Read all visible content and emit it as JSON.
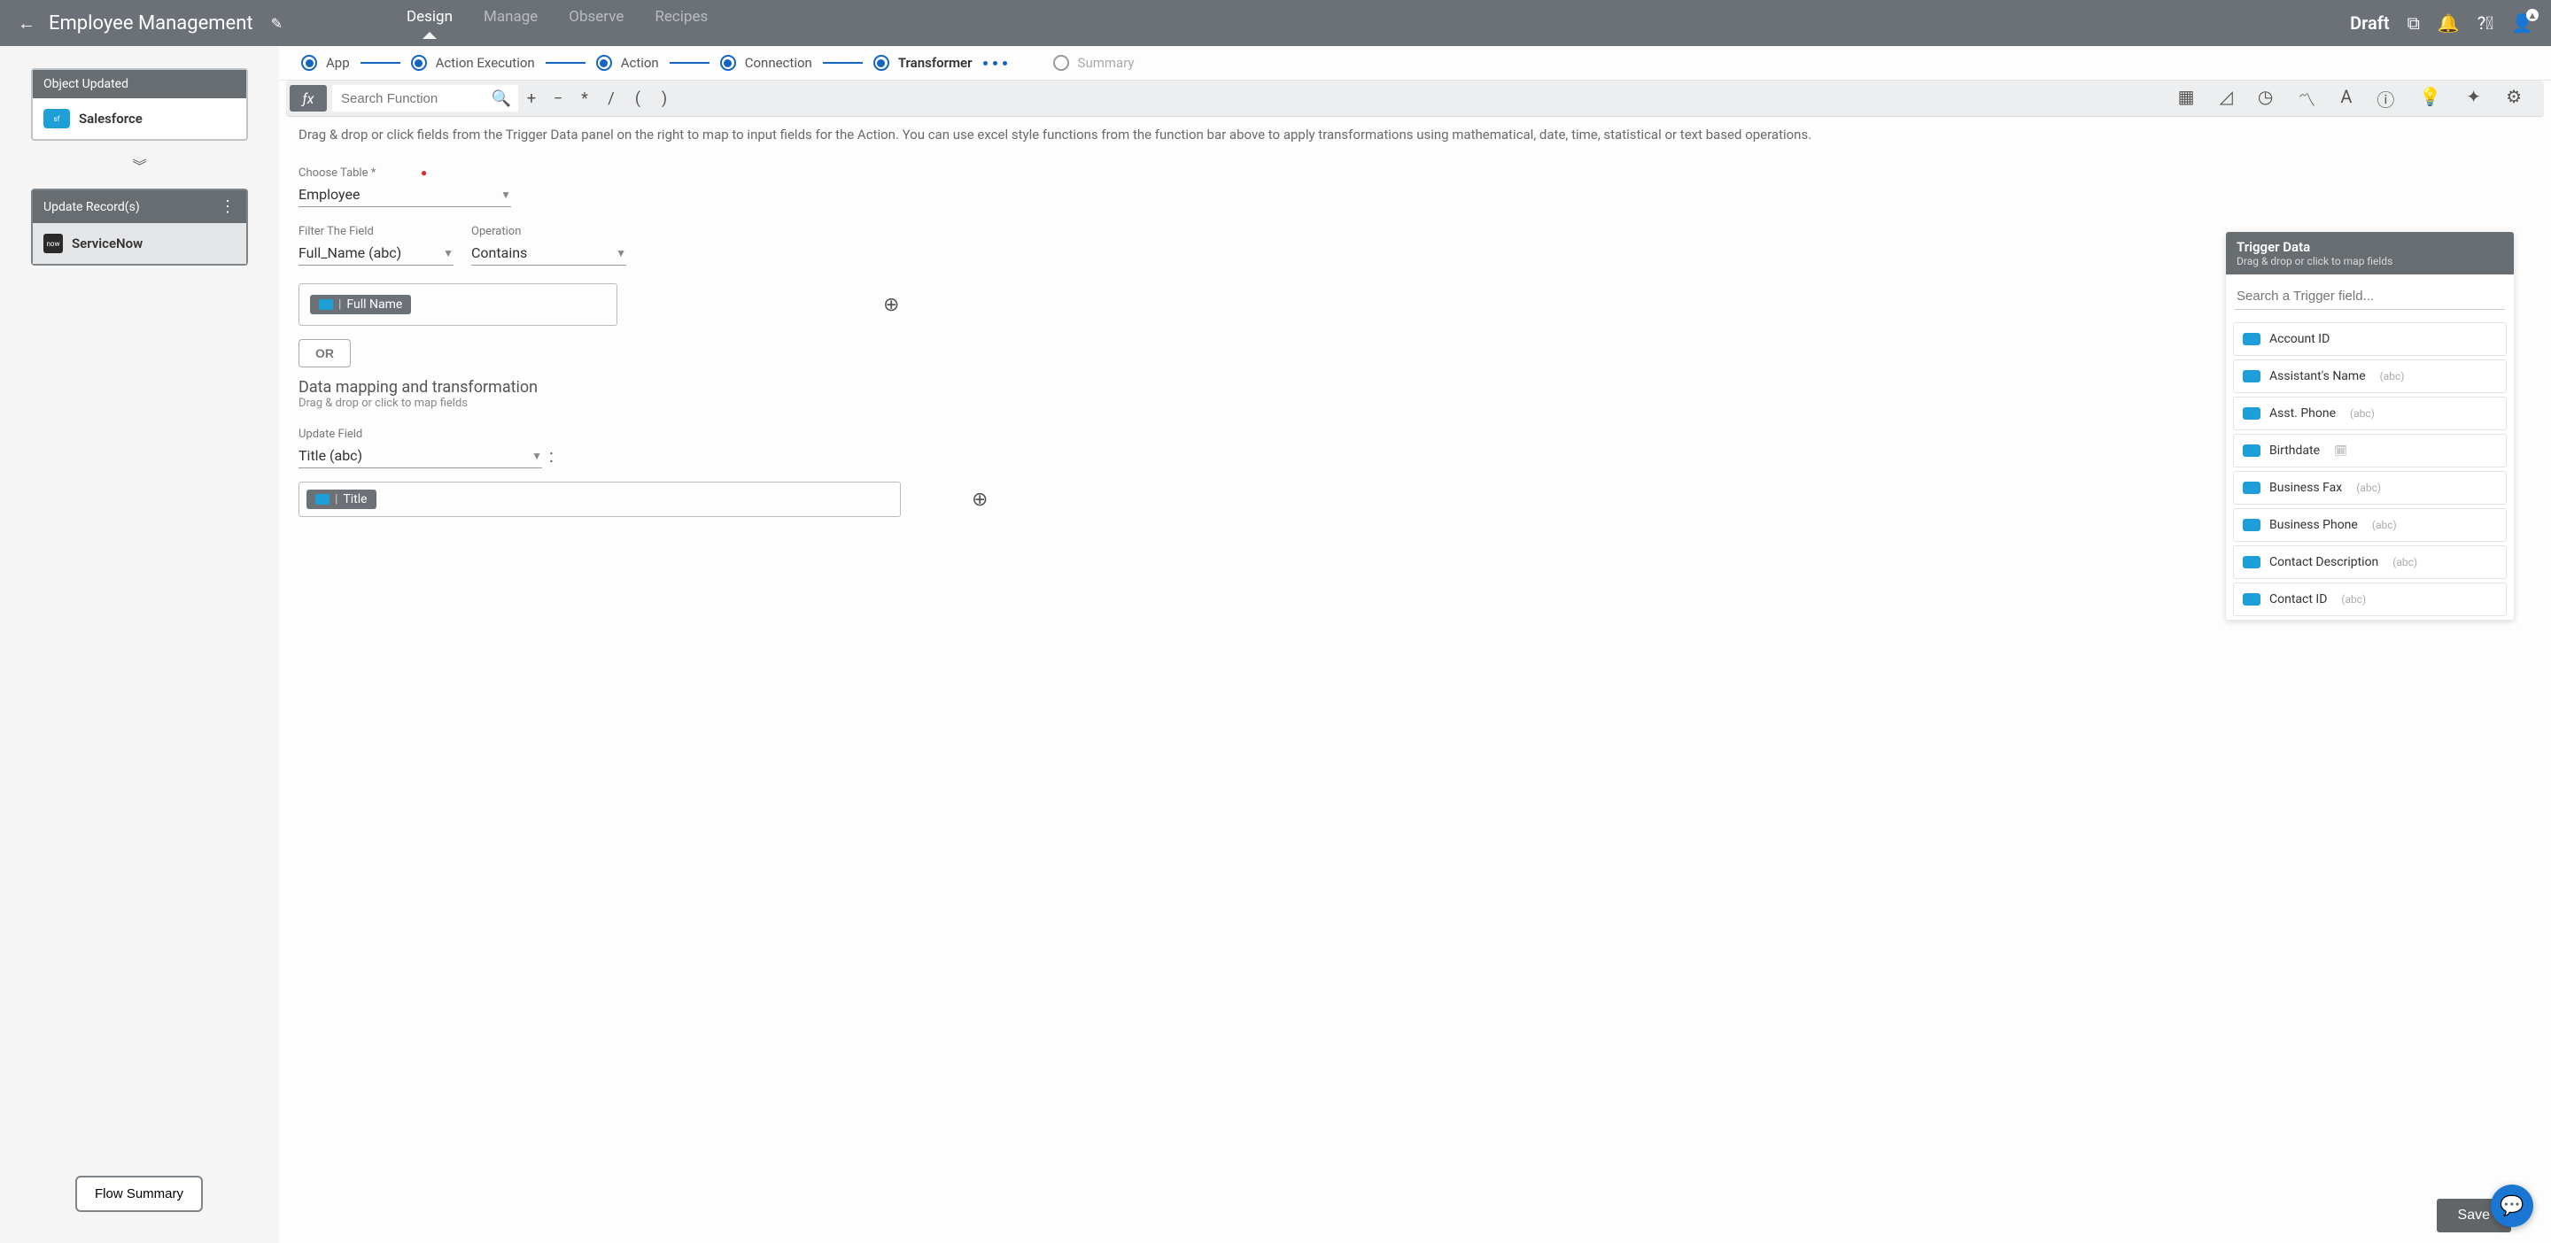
{
  "header": {
    "title": "Employee Management",
    "tabs": [
      "Design",
      "Manage",
      "Observe",
      "Recipes"
    ],
    "active_tab": "Design",
    "status": "Draft"
  },
  "sidebar": {
    "card1": {
      "header": "Object Updated",
      "provider": "Salesforce"
    },
    "card2": {
      "header": "Update Record(s)",
      "provider": "ServiceNow"
    },
    "flow_summary_btn": "Flow Summary"
  },
  "steps": [
    "App",
    "Action Execution",
    "Action",
    "Connection",
    "Transformer",
    "Summary"
  ],
  "active_step": "Transformer",
  "fn_bar": {
    "search_placeholder": "Search Function",
    "ops": [
      "+",
      "−",
      "*",
      "/",
      "(",
      ")"
    ]
  },
  "panel": {
    "helper": "Drag & drop or click fields from the Trigger Data panel on the right to map to input fields for the Action. You can use excel style functions from the function bar above to apply transformations using mathematical, date, time, statistical or text based operations.",
    "choose_table_label": "Choose Table *",
    "choose_table_value": "Employee",
    "filter_field_label": "Filter The Field",
    "filter_field_value": "Full_Name (abc)",
    "operation_label": "Operation",
    "operation_value": "Contains",
    "filter_chip": "Full Name",
    "or_btn": "OR",
    "mapping_title": "Data mapping and transformation",
    "mapping_sub": "Drag & drop or click to map fields",
    "update_field_label": "Update Field",
    "update_field_value": "Title (abc)",
    "title_chip": "Title",
    "save_btn": "Save"
  },
  "trigger": {
    "title": "Trigger Data",
    "sub": "Drag & drop or click to map fields",
    "search_placeholder": "Search a Trigger field...",
    "items": [
      {
        "name": "Account ID",
        "type": ""
      },
      {
        "name": "Assistant's Name",
        "type": "(abc)"
      },
      {
        "name": "Asst. Phone",
        "type": "(abc)"
      },
      {
        "name": "Birthdate",
        "type": "date"
      },
      {
        "name": "Business Fax",
        "type": "(abc)"
      },
      {
        "name": "Business Phone",
        "type": "(abc)"
      },
      {
        "name": "Contact Description",
        "type": "(abc)"
      },
      {
        "name": "Contact ID",
        "type": "(abc)"
      }
    ]
  }
}
